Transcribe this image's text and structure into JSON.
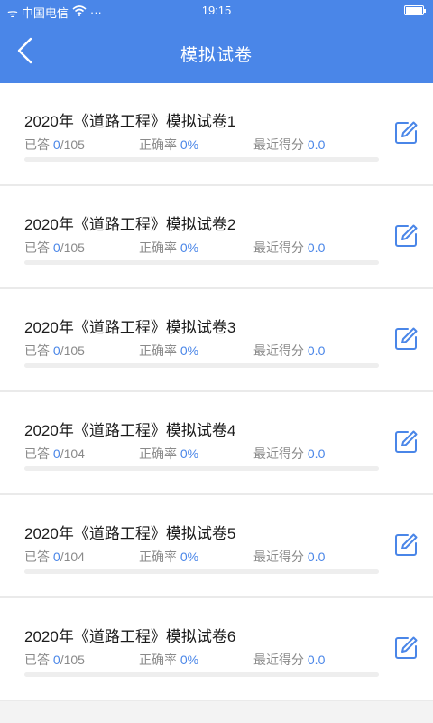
{
  "status_bar": {
    "signal_text": "ᯤ",
    "carrier": "中国电信",
    "wifi_icon": "wifi-icon",
    "more": "···",
    "time": "19:15",
    "battery_level": 1.0
  },
  "nav": {
    "title": "模拟试卷",
    "back_icon": "chevron-left-icon"
  },
  "colors": {
    "primary": "#4a86e8",
    "value_blue": "#4a86e8",
    "muted_text": "#8a8a8a",
    "title_text": "#1c1c1c",
    "background": "#f3f3f3"
  },
  "labels": {
    "answered": "已答",
    "accuracy": "正确率",
    "recent_score": "最近得分"
  },
  "exams": [
    {
      "title": "2020年《道路工程》模拟试卷1",
      "answered": "0",
      "total": "105",
      "accuracy": "0%",
      "score": "0.0",
      "progress": 0,
      "action_icon": "edit-icon"
    },
    {
      "title": "2020年《道路工程》模拟试卷2",
      "answered": "0",
      "total": "105",
      "accuracy": "0%",
      "score": "0.0",
      "progress": 0,
      "action_icon": "edit-icon"
    },
    {
      "title": "2020年《道路工程》模拟试卷3",
      "answered": "0",
      "total": "105",
      "accuracy": "0%",
      "score": "0.0",
      "progress": 0,
      "action_icon": "edit-icon"
    },
    {
      "title": "2020年《道路工程》模拟试卷4",
      "answered": "0",
      "total": "104",
      "accuracy": "0%",
      "score": "0.0",
      "progress": 0,
      "action_icon": "edit-icon"
    },
    {
      "title": "2020年《道路工程》模拟试卷5",
      "answered": "0",
      "total": "104",
      "accuracy": "0%",
      "score": "0.0",
      "progress": 0,
      "action_icon": "edit-icon"
    },
    {
      "title": "2020年《道路工程》模拟试卷6",
      "answered": "0",
      "total": "105",
      "accuracy": "0%",
      "score": "0.0",
      "progress": 0,
      "action_icon": "edit-icon"
    }
  ]
}
